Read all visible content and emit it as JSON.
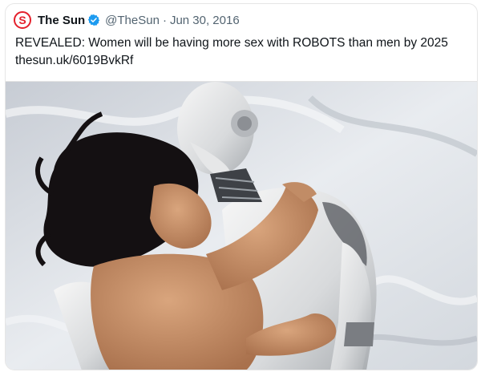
{
  "tweet": {
    "author_name": "The Sun",
    "handle": "@TheSun",
    "separator": "·",
    "date": "Jun 30, 2016",
    "text": "REVEALED: Women will be having more sex with ROBOTS than men by 2025",
    "link": "thesun.uk/6019BvkRf"
  },
  "icons": {
    "logo": "the-sun-logo",
    "verified": "verified-badge-icon"
  },
  "colors": {
    "logo_red": "#e4202c",
    "verified_blue": "#1d9bf0",
    "muted_text": "#536471",
    "sheet": "#dfe3e8"
  }
}
